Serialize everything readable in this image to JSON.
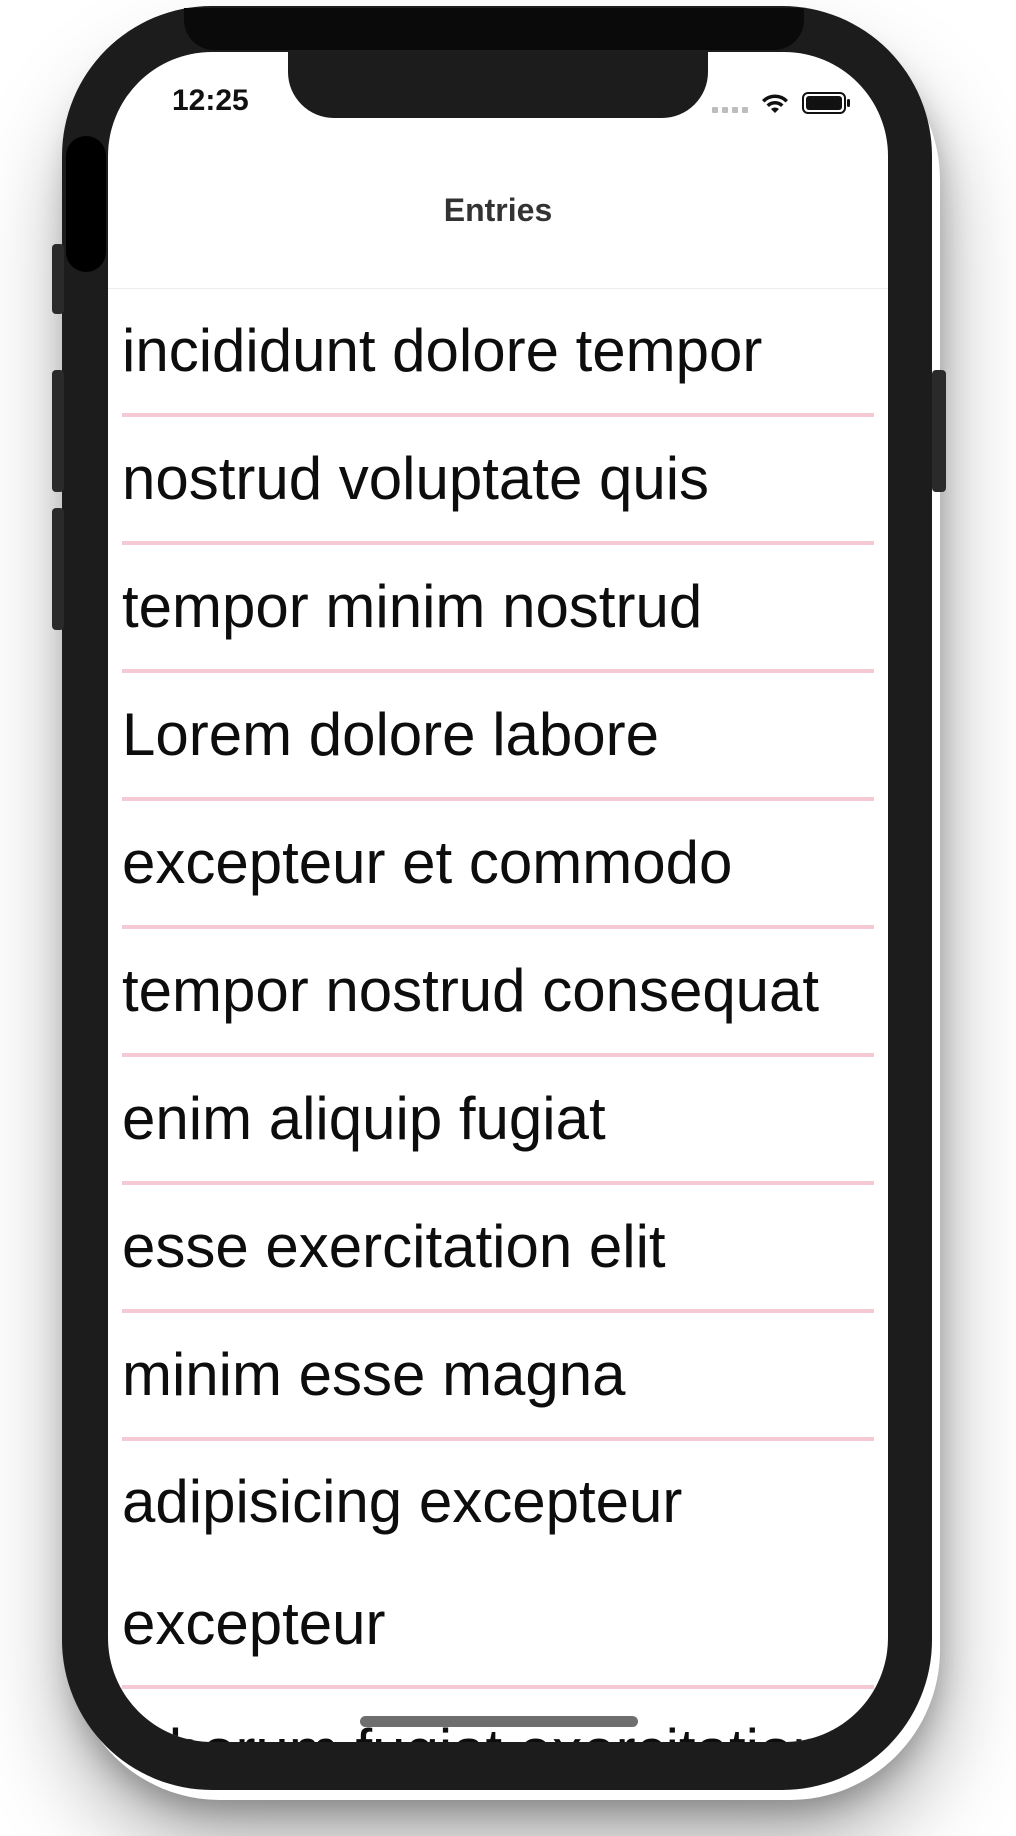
{
  "status_bar": {
    "time": "12:25",
    "signal_icon": "cellular-signal-dots",
    "wifi_icon": "wifi-icon",
    "battery_icon": "battery-icon"
  },
  "nav": {
    "title": "Entries"
  },
  "entries": [
    "incididunt dolore tempor",
    "nostrud voluptate quis",
    "tempor minim nostrud",
    "Lorem dolore labore",
    "excepteur et commodo",
    "tempor nostrud consequat",
    "enim aliquip fugiat",
    "esse exercitation elit",
    "minim esse magna",
    "adipisicing excepteur excepteur",
    "laborum fugiat exercitation"
  ],
  "colors": {
    "separator": "#f7c9d4",
    "text": "#0d0d0d",
    "phone_frame": "#1c1c1c"
  }
}
